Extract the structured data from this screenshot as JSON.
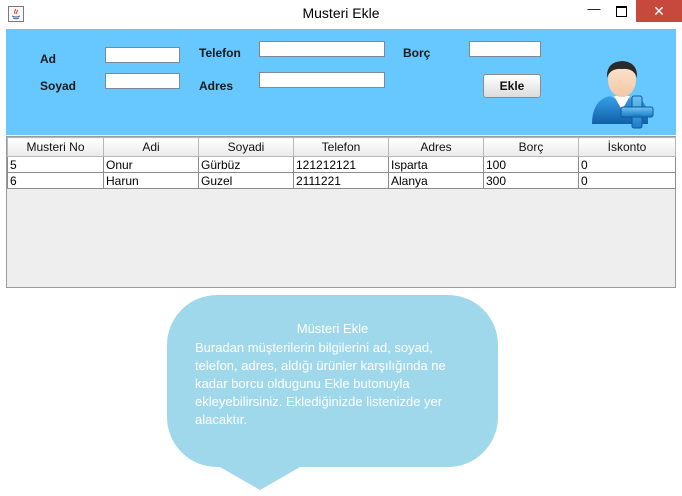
{
  "window": {
    "title": "Musteri Ekle",
    "minimize_glyph": "—",
    "close_glyph": "✕"
  },
  "form": {
    "ad_label": "Ad",
    "soyad_label": "Soyad",
    "telefon_label": "Telefon",
    "adres_label": "Adres",
    "borc_label": "Borç",
    "ad_value": "",
    "soyad_value": "",
    "telefon_value": "",
    "adres_value": "",
    "borc_value": "",
    "ekle_button": "Ekle",
    "avatar_icon": "add-user-icon"
  },
  "table": {
    "columns": [
      "Musteri No",
      "Adi",
      "Soyadi",
      "Telefon",
      "Adres",
      "Borç",
      "İskonto"
    ],
    "rows": [
      [
        "5",
        "Onur",
        "Gürbüz",
        "121212121",
        "Isparta",
        "100",
        "0"
      ],
      [
        "6",
        "Harun",
        "Guzel",
        "2111221",
        "Alanya",
        "300",
        "0"
      ]
    ]
  },
  "tooltip": {
    "title": "Müsteri Ekle",
    "body": "Buradan müşterilerin bilgilerini ad, soyad, telefon, adres, aldığı ürünler karşılığında ne kadar borcu oldugunu Ekle butonuyla ekleyebilirsiniz. Eklediğinizde listenizde yer alacaktır."
  },
  "colors": {
    "panel": "#66c8ff",
    "close_button": "#c7483c",
    "bubble": "#9fd8ea"
  }
}
